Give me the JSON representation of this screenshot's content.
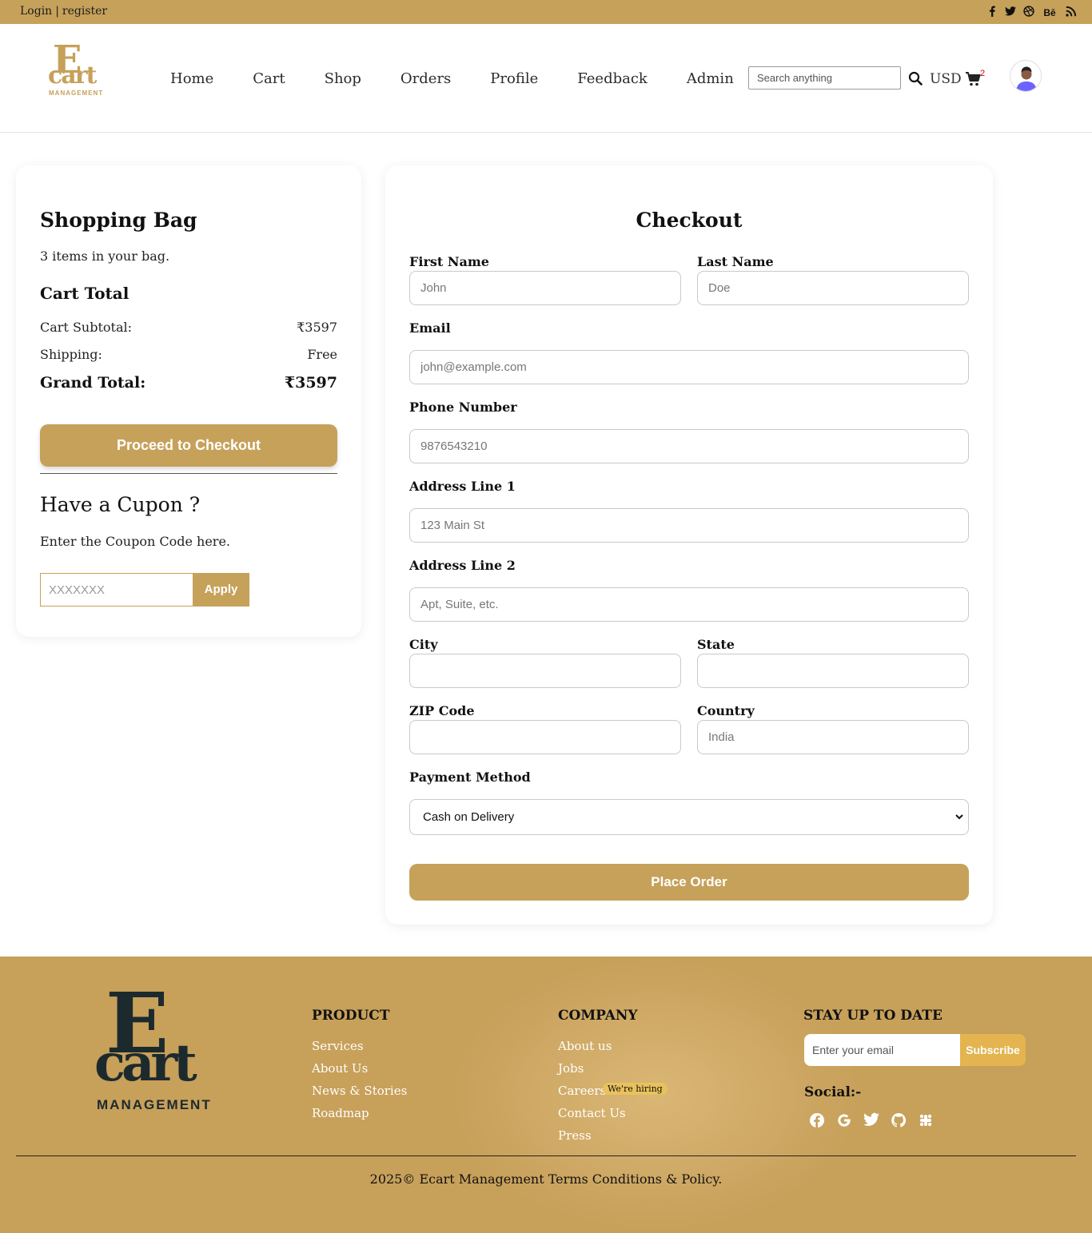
{
  "topbar": {
    "login": "Login",
    "separator": "|",
    "register": "register",
    "social_icons": [
      "facebook-icon",
      "twitter-icon",
      "dribbble-icon",
      "behance-icon",
      "rss-icon"
    ],
    "behance_text": "Bē"
  },
  "brand": {
    "letter": "E",
    "word": "cart",
    "tagline": "MANAGEMENT"
  },
  "nav": [
    "Home",
    "Cart",
    "Shop",
    "Orders",
    "Profile",
    "Feedback",
    "Admin"
  ],
  "search": {
    "placeholder": "Search anything"
  },
  "currency": "USD",
  "cart_count": "2",
  "bag": {
    "title": "Shopping Bag",
    "count_text": "3 items in your bag.",
    "total_title": "Cart Total",
    "subtotal_label": "Cart Subtotal:",
    "subtotal_value": "₹3597",
    "shipping_label": "Shipping:",
    "shipping_value": "Free",
    "grand_label": "Grand Total:",
    "grand_value": "₹3597",
    "proceed_label": "Proceed to Checkout",
    "coupon_title": "Have a Cupon ?",
    "coupon_hint": "Enter the Coupon Code here.",
    "coupon_placeholder": "XXXXXXX",
    "apply_label": "Apply"
  },
  "checkout": {
    "title": "Checkout",
    "first_name": {
      "label": "First Name",
      "placeholder": "John"
    },
    "last_name": {
      "label": "Last Name",
      "placeholder": "Doe"
    },
    "email": {
      "label": "Email",
      "placeholder": "john@example.com"
    },
    "phone": {
      "label": "Phone Number",
      "placeholder": "9876543210"
    },
    "address1": {
      "label": "Address Line 1",
      "placeholder": "123 Main St"
    },
    "address2": {
      "label": "Address Line 2",
      "placeholder": "Apt, Suite, etc."
    },
    "city": {
      "label": "City",
      "placeholder": ""
    },
    "state": {
      "label": "State",
      "placeholder": ""
    },
    "zip": {
      "label": "ZIP Code",
      "placeholder": ""
    },
    "country": {
      "label": "Country",
      "placeholder": "India"
    },
    "payment": {
      "label": "Payment Method",
      "selected": "Cash on Delivery"
    },
    "place_order_label": "Place Order"
  },
  "footer": {
    "product": {
      "title": "PRODUCT",
      "links": [
        "Services",
        "About Us",
        "News & Stories",
        "Roadmap"
      ]
    },
    "company": {
      "title": "COMPANY",
      "links": [
        "About us",
        "Jobs",
        "Careers",
        "Contact Us",
        "Press"
      ],
      "hiring_badge": "We're hiring"
    },
    "newsletter": {
      "title": "STAY UP TO DATE",
      "placeholder": "Enter your email",
      "subscribe_label": "Subscribe"
    },
    "social_label": "Social:-",
    "social_icons": [
      "facebook-icon",
      "google-icon",
      "twitter-icon",
      "github-icon",
      "slack-icon"
    ],
    "copyright": "2025© Ecart Management Terms Conditions & Policy."
  },
  "colors": {
    "accent": "#c6a15a",
    "footer_bg": "#c7a05a",
    "badge": "#e8c25c"
  }
}
